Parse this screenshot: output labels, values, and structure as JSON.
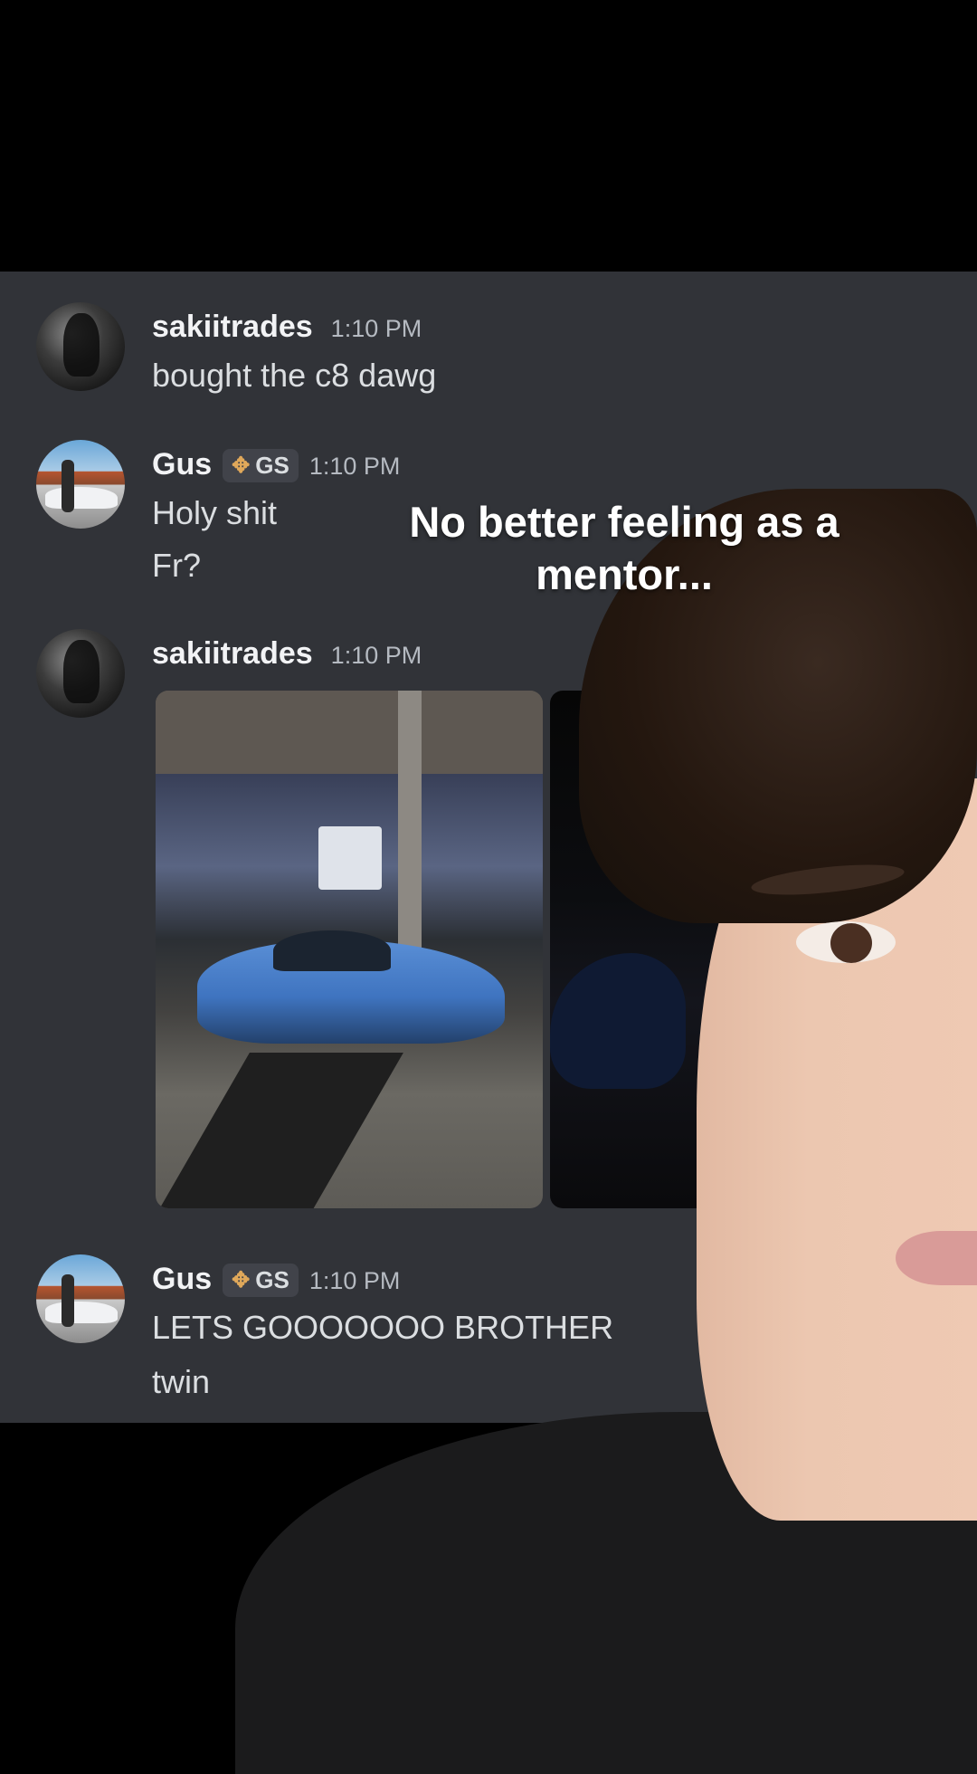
{
  "messages": [
    {
      "username": "sakiitrades",
      "time": "1:10 PM",
      "lines": [
        "bought the c8 dawg"
      ]
    },
    {
      "username": "Gus",
      "tag": "GS",
      "time": "1:10 PM",
      "lines": [
        "Holy shit",
        "Fr?"
      ]
    },
    {
      "username": "sakiitrades",
      "time": "1:10 PM",
      "lines": []
    },
    {
      "username": "Gus",
      "tag": "GS",
      "time": "1:10 PM",
      "lines": [
        "LETS GOOOOOOO BROTHER",
        "twin"
      ]
    }
  ],
  "caption": {
    "line1": "No better feeling as a",
    "line2": "mentor..."
  },
  "icons": {
    "tag_icon": "diamond-badge-icon"
  },
  "colors": {
    "chat_bg": "#313338",
    "username": "#f2f3f5",
    "timestamp": "#b5bac1",
    "message": "#dbdee1"
  }
}
